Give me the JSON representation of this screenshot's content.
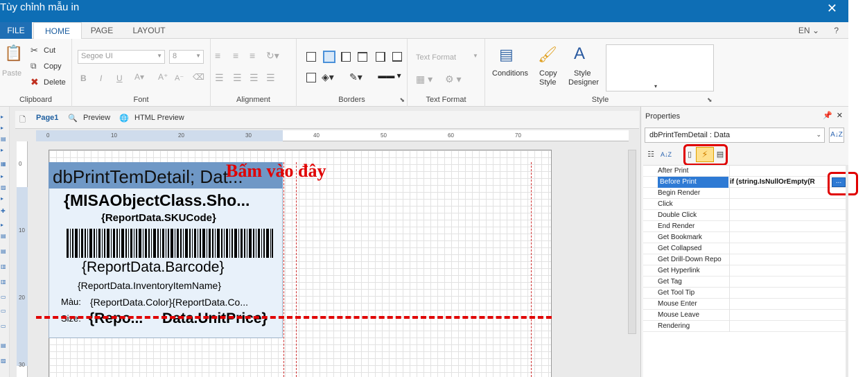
{
  "window": {
    "title": "Tùy chỉnh mẫu in",
    "close_glyph": "✕"
  },
  "tabs": {
    "file": "FILE",
    "home": "HOME",
    "page": "PAGE",
    "layout": "LAYOUT",
    "lang": "EN",
    "help": "?"
  },
  "ribbon": {
    "clipboard": {
      "paste": "Paste",
      "cut": "Cut",
      "copy": "Copy",
      "delete": "Delete",
      "label": "Clipboard"
    },
    "font": {
      "family": "Segoe UI",
      "size": "8",
      "label": "Font"
    },
    "alignment": {
      "label": "Alignment"
    },
    "borders": {
      "label": "Borders"
    },
    "text_format": {
      "combo": "Text Format",
      "label": "Text Format"
    },
    "style": {
      "conditions": "Conditions",
      "copy_style_1": "Copy",
      "copy_style_2": "Style",
      "designer_1": "Style",
      "designer_2": "Designer",
      "label": "Style"
    }
  },
  "designer": {
    "tabs": {
      "page1": "Page1",
      "preview": "Preview",
      "html_preview": "HTML Preview"
    },
    "ruler_h": [
      "0",
      "10",
      "20",
      "30",
      "40",
      "50",
      "60",
      "70"
    ],
    "ruler_v": [
      "0",
      "10",
      "20",
      "30"
    ],
    "band_header": "dbPrintTemDetail;  Dat...",
    "fields": {
      "shortname": "{MISAObjectClass.Sho...",
      "sku": "{ReportData.SKUCode}",
      "barcode": "{ReportData.Barcode}",
      "item_name": "{ReportData.InventoryItemName}",
      "color_label": "Màu:",
      "color_value": "{ReportData.Color}{ReportData.Co...",
      "size_label": "Size:",
      "size_value": "{Repo...",
      "price": "Data.UnitPrice}"
    },
    "annotation": "Bấm vào đây"
  },
  "properties": {
    "title": "Properties",
    "pin_glyph": "📌",
    "close_glyph": "✕",
    "object": "dbPrintTemDetail : Data",
    "events": [
      {
        "name": "After Print",
        "value": ""
      },
      {
        "name": "Before Print",
        "value": "if (string.IsNullOrEmpty(R",
        "selected": true
      },
      {
        "name": "Begin Render",
        "value": ""
      },
      {
        "name": "Click",
        "value": ""
      },
      {
        "name": "Double Click",
        "value": ""
      },
      {
        "name": "End Render",
        "value": ""
      },
      {
        "name": "Get Bookmark",
        "value": ""
      },
      {
        "name": "Get Collapsed",
        "value": ""
      },
      {
        "name": "Get Drill-Down Repo",
        "value": ""
      },
      {
        "name": "Get Hyperlink",
        "value": ""
      },
      {
        "name": "Get Tag",
        "value": ""
      },
      {
        "name": "Get Tool Tip",
        "value": ""
      },
      {
        "name": "Mouse Enter",
        "value": ""
      },
      {
        "name": "Mouse Leave",
        "value": ""
      },
      {
        "name": "Rendering",
        "value": ""
      }
    ],
    "ellipsis": "..."
  }
}
